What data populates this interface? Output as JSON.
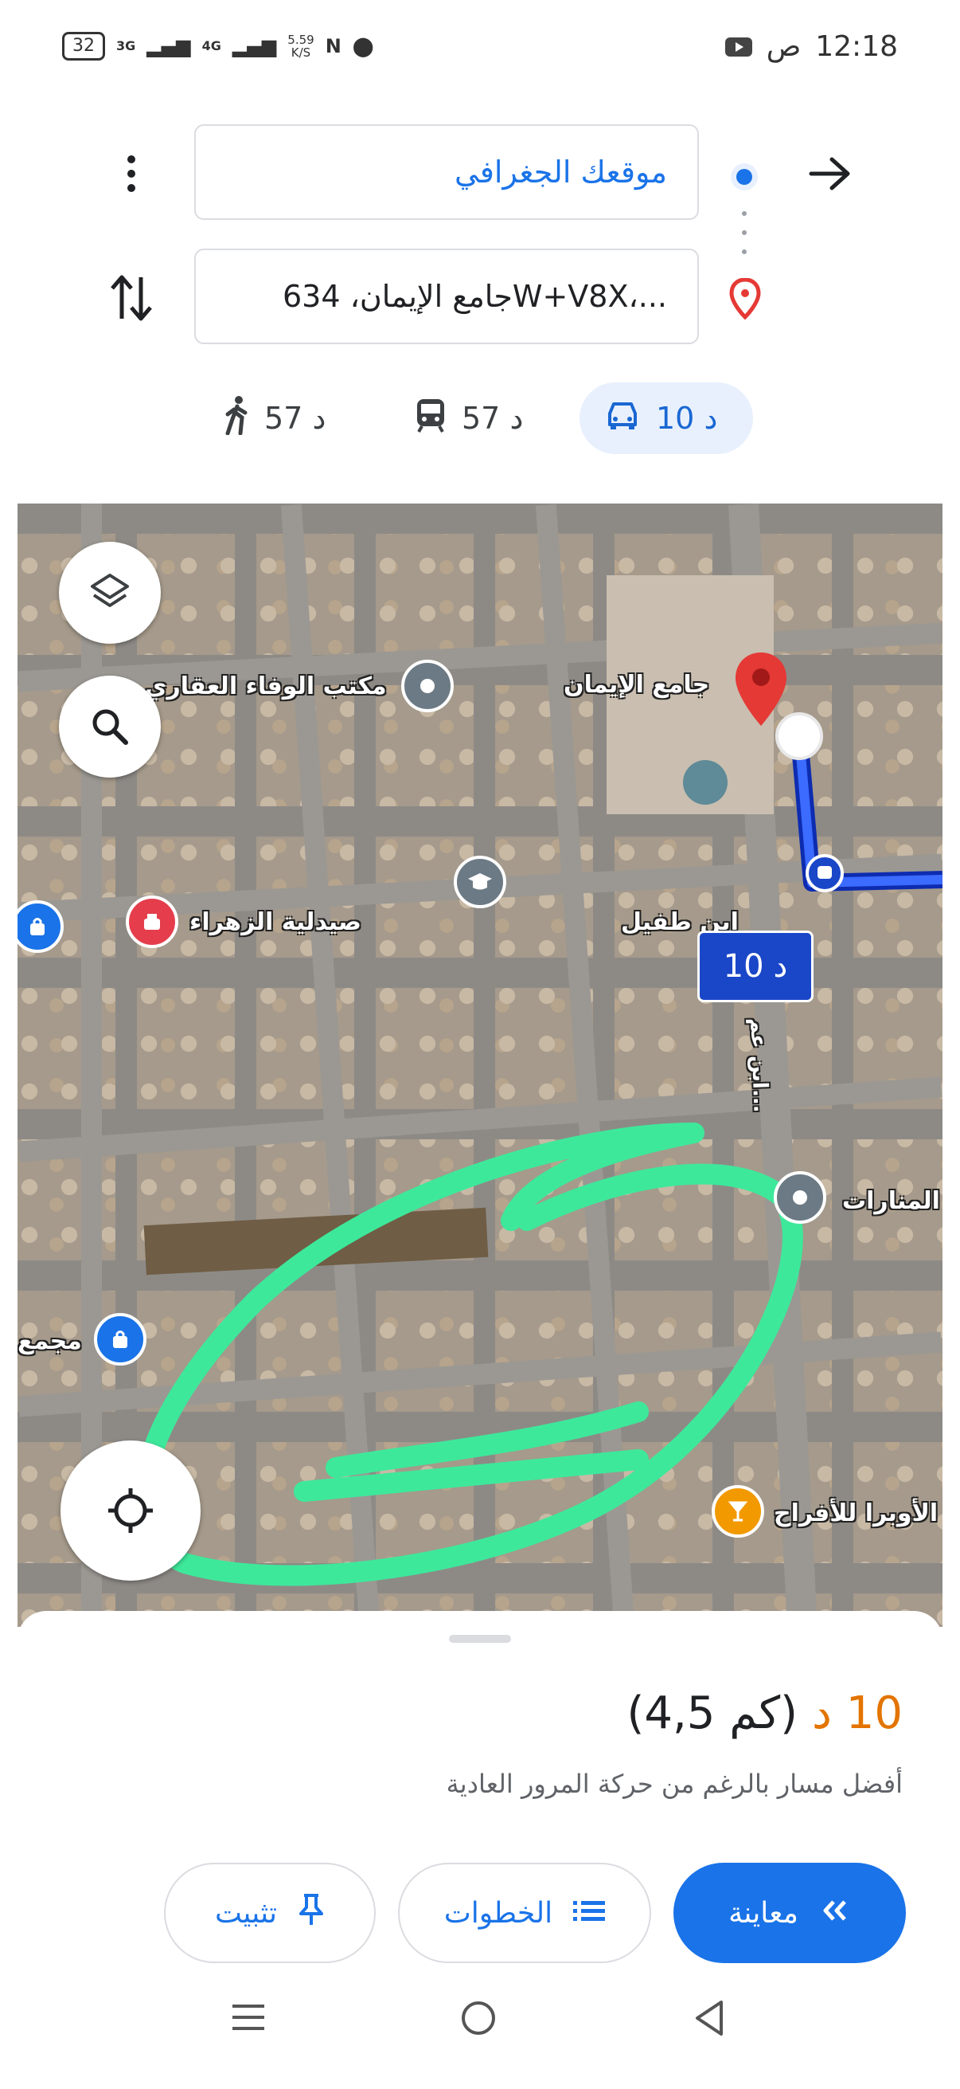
{
  "status_bar": {
    "battery": "32",
    "network_1": "3G",
    "network_2": "4G",
    "speed_value": "5.59",
    "speed_unit": "K/S",
    "time": "12:18",
    "ampm": "ص"
  },
  "directions": {
    "origin": "موقعك الجغرافي",
    "destination": "جامع الإيمان، 634W+V8X،...",
    "more_icon": "more-vertical-icon",
    "swap_icon": "swap-vertical-icon"
  },
  "modes": [
    {
      "name": "drive",
      "label": "10 د",
      "icon": "car-icon",
      "active": true
    },
    {
      "name": "transit",
      "label": "57 د",
      "icon": "train-icon",
      "active": false
    },
    {
      "name": "walk",
      "label": "57 د",
      "icon": "walk-icon",
      "active": false
    }
  ],
  "map": {
    "labels": {
      "mosque": "جامع الإيمان",
      "office": "مكتب الوفاء العقاري",
      "pharmacy": "صيدلية الزهراء",
      "street1": "ابن طفيل",
      "street2": "ابن عم...",
      "venue": "الأوبرا للأفراح",
      "complex": "مجمع",
      "manarat": "المنارات"
    },
    "route_time": "10",
    "route_unit": "د",
    "colors": {
      "route": "#1a46c8",
      "highlight": "#3ee89a",
      "destination_pin": "#e53935"
    }
  },
  "sheet": {
    "time_value": "10 د",
    "distance": "(4,5 كم)",
    "note": "أفضل مسار بالرغم من حركة المرور العادية",
    "buttons": {
      "preview": "معاينة",
      "steps": "الخطوات",
      "pin": "تثبيت"
    }
  }
}
